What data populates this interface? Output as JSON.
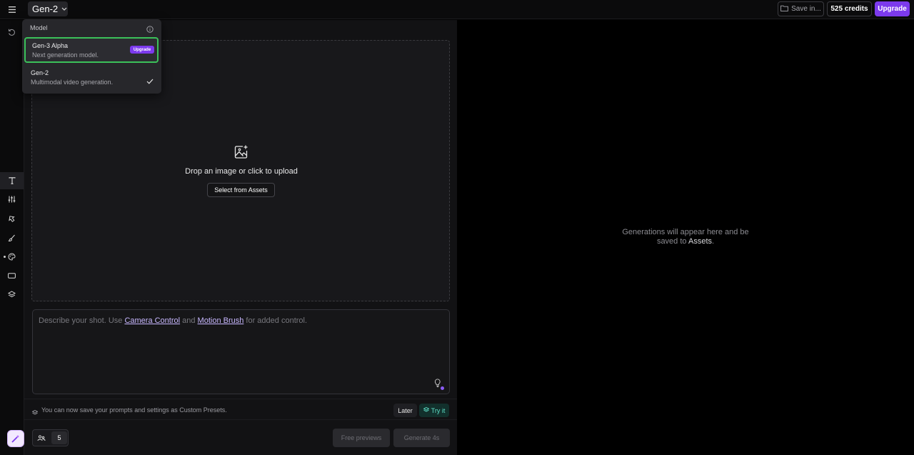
{
  "topbar": {
    "model_label": "Gen-2",
    "save_label": "Save in...",
    "credits_label": "525 credits",
    "upgrade_label": "Upgrade"
  },
  "sidebar": {
    "items": [
      {
        "name": "undo-icon"
      },
      {
        "name": "text-tool-icon"
      },
      {
        "name": "sliders-icon"
      },
      {
        "name": "camera-control-icon"
      },
      {
        "name": "motion-brush-icon"
      },
      {
        "name": "palette-icon"
      },
      {
        "name": "aspect-ratio-icon"
      },
      {
        "name": "layers-icon"
      }
    ],
    "app_icon": "magic-wand-icon"
  },
  "dropdown": {
    "header": "Model",
    "options": [
      {
        "title": "Gen-3 Alpha",
        "subtitle": "Next generation model.",
        "badge": "Upgrade",
        "selected_highlight": true
      },
      {
        "title": "Gen-2",
        "subtitle": "Multimodal video generation.",
        "checked": true
      }
    ]
  },
  "upload": {
    "text": "Drop an image or click to upload",
    "button": "Select from Assets"
  },
  "prompt": {
    "placeholder_start": "Describe your shot. Use ",
    "link1": "Camera Control",
    "middle": " and ",
    "link2": "Motion Brush",
    "placeholder_end": " for added control."
  },
  "notice": {
    "text": "You can now save your prompts and settings as Custom Presets.",
    "later": "Later",
    "try": "Try it"
  },
  "bottom": {
    "seed_count": "5",
    "free_previews": "Free previews",
    "generate": "Generate 4s"
  },
  "preview": {
    "message_part1": "Generations will appear here and be saved to ",
    "assets_link": "Assets",
    "period": "."
  },
  "colors": {
    "accent": "#7c3aed",
    "selection_border": "#3bc15a",
    "try_it": "#5ee0c8"
  }
}
